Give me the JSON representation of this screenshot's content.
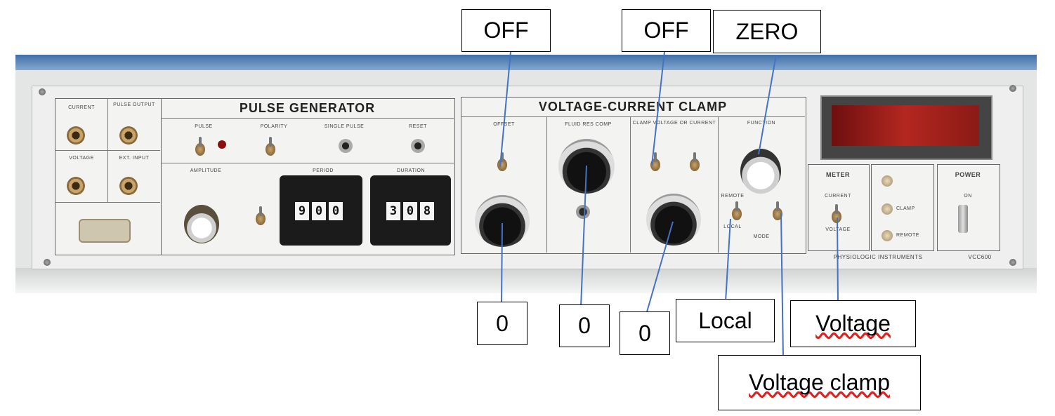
{
  "pulse_generator": {
    "title": "PULSE GENERATOR",
    "labels": {
      "pulse": "PULSE",
      "polarity": "POLARITY",
      "single_pulse": "SINGLE PULSE",
      "reset": "RESET",
      "amplitude": "AMPLITUDE",
      "period": "PERIOD",
      "duration": "DURATION"
    },
    "period_digits": [
      "9",
      "0",
      "0"
    ],
    "duration_digits": [
      "3",
      "0",
      "8"
    ]
  },
  "voltage_current_clamp": {
    "title": "VOLTAGE-CURRENT CLAMP",
    "labels": {
      "offset": "OFFSET",
      "fluid res comp": "FLUID RES COMP",
      "clamp": "CLAMP VOLTAGE OR CURRENT",
      "function": "FUNCTION",
      "mode": "MODE",
      "remote": "REMOTE",
      "local": "LOCAL"
    }
  },
  "side_panels": {
    "meter": "METER",
    "meter_current": "CURRENT",
    "meter_voltage": "VOLTAGE",
    "clamp": "CLAMP",
    "remote": "REMOTE",
    "power": "POWER",
    "power_on": "ON",
    "brand": "PHYSIOLOGIC INSTRUMENTS",
    "model": "VCC600"
  },
  "connectors": {
    "current": "CURRENT",
    "pulse_output": "PULSE OUTPUT",
    "voltage": "VOLTAGE",
    "ext_input": "EXT. INPUT"
  },
  "callouts": {
    "offset_switch": "OFF",
    "clamp_switch": "OFF",
    "function_knob": "ZERO",
    "offset_knob": "0",
    "fluid_res_knob": "0",
    "clamp_knob": "0",
    "mode_local": "Local",
    "meter_setting": "Voltage",
    "mode_clamp": "Voltage clamp"
  },
  "colors": {
    "callout_line": "#4472c4",
    "top_lip": "#3f6fa8",
    "led_display": "#b3271f"
  }
}
